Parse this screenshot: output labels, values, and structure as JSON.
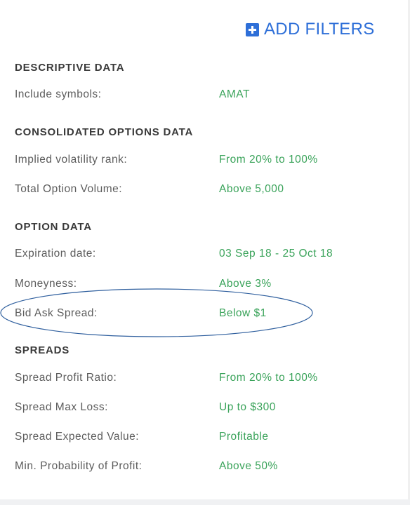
{
  "header": {
    "add_filters_label": "ADD FILTERS",
    "add_icon": "plus-square-icon",
    "accent_color": "#2e6fd8"
  },
  "value_color": "#3aa35a",
  "sections": {
    "descriptive": {
      "title": "DESCRIPTIVE DATA",
      "rows": [
        {
          "label": "Include symbols:",
          "value": "AMAT"
        }
      ]
    },
    "consolidated": {
      "title": "CONSOLIDATED OPTIONS DATA",
      "rows": [
        {
          "label": "Implied volatility rank:",
          "value": "From 20% to 100%"
        },
        {
          "label": "Total Option Volume:",
          "value": "Above 5,000"
        }
      ]
    },
    "option": {
      "title": "OPTION DATA",
      "rows": [
        {
          "label": "Expiration date:",
          "value": "03 Sep 18 - 25 Oct 18"
        },
        {
          "label": "Moneyness:",
          "value": "Above 3%"
        },
        {
          "label": "Bid Ask Spread:",
          "value": "Below $1"
        }
      ]
    },
    "spreads": {
      "title": "SPREADS",
      "rows": [
        {
          "label": "Spread Profit Ratio:",
          "value": "From 20% to 100%"
        },
        {
          "label": "Spread Max Loss:",
          "value": "Up to $300"
        },
        {
          "label": "Spread Expected Value:",
          "value": "Profitable"
        },
        {
          "label": "Min. Probability of Profit:",
          "value": "Above 50%"
        }
      ]
    }
  },
  "annotation": {
    "highlight_color": "#2f5f9e"
  }
}
